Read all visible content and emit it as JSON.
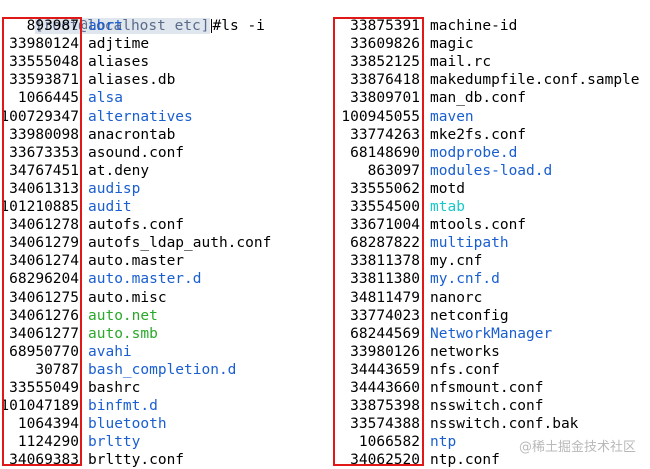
{
  "prompt": {
    "host": "[root@localhost etc]",
    "command": "#ls -i"
  },
  "colors": {
    "dir": "#1a5fd0",
    "exec": "#2aa82a",
    "link": "#18c8c8",
    "highlight_box": "#e01818"
  },
  "left_column": [
    {
      "inode": "893987",
      "name": "abrt",
      "type": "dir"
    },
    {
      "inode": "33980124",
      "name": "adjtime",
      "type": "file"
    },
    {
      "inode": "33555048",
      "name": "aliases",
      "type": "file"
    },
    {
      "inode": "33593871",
      "name": "aliases.db",
      "type": "file"
    },
    {
      "inode": "1066445",
      "name": "alsa",
      "type": "dir"
    },
    {
      "inode": "100729347",
      "name": "alternatives",
      "type": "dir"
    },
    {
      "inode": "33980098",
      "name": "anacrontab",
      "type": "file"
    },
    {
      "inode": "33673353",
      "name": "asound.conf",
      "type": "file"
    },
    {
      "inode": "34767451",
      "name": "at.deny",
      "type": "file"
    },
    {
      "inode": "34061313",
      "name": "audisp",
      "type": "dir"
    },
    {
      "inode": "101210885",
      "name": "audit",
      "type": "dir"
    },
    {
      "inode": "34061278",
      "name": "autofs.conf",
      "type": "file"
    },
    {
      "inode": "34061279",
      "name": "autofs_ldap_auth.conf",
      "type": "file"
    },
    {
      "inode": "34061274",
      "name": "auto.master",
      "type": "file"
    },
    {
      "inode": "68296204",
      "name": "auto.master.d",
      "type": "dir"
    },
    {
      "inode": "34061275",
      "name": "auto.misc",
      "type": "file"
    },
    {
      "inode": "34061276",
      "name": "auto.net",
      "type": "exec"
    },
    {
      "inode": "34061277",
      "name": "auto.smb",
      "type": "exec"
    },
    {
      "inode": "68950770",
      "name": "avahi",
      "type": "dir"
    },
    {
      "inode": "30787",
      "name": "bash_completion.d",
      "type": "dir"
    },
    {
      "inode": "33555049",
      "name": "bashrc",
      "type": "file"
    },
    {
      "inode": "101047189",
      "name": "binfmt.d",
      "type": "dir"
    },
    {
      "inode": "1064394",
      "name": "bluetooth",
      "type": "dir"
    },
    {
      "inode": "1124290",
      "name": "brltty",
      "type": "dir"
    },
    {
      "inode": "34069383",
      "name": "brltty.conf",
      "type": "file"
    }
  ],
  "right_column": [
    {
      "inode": "33875391",
      "name": "machine-id",
      "type": "file"
    },
    {
      "inode": "33609826",
      "name": "magic",
      "type": "file"
    },
    {
      "inode": "33852125",
      "name": "mail.rc",
      "type": "file"
    },
    {
      "inode": "33876418",
      "name": "makedumpfile.conf.sample",
      "type": "file"
    },
    {
      "inode": "33809701",
      "name": "man_db.conf",
      "type": "file"
    },
    {
      "inode": "100945055",
      "name": "maven",
      "type": "dir"
    },
    {
      "inode": "33774263",
      "name": "mke2fs.conf",
      "type": "file"
    },
    {
      "inode": "68148690",
      "name": "modprobe.d",
      "type": "dir"
    },
    {
      "inode": "863097",
      "name": "modules-load.d",
      "type": "dir"
    },
    {
      "inode": "33555062",
      "name": "motd",
      "type": "file"
    },
    {
      "inode": "33554500",
      "name": "mtab",
      "type": "link"
    },
    {
      "inode": "33671004",
      "name": "mtools.conf",
      "type": "file"
    },
    {
      "inode": "68287822",
      "name": "multipath",
      "type": "dir"
    },
    {
      "inode": "33811378",
      "name": "my.cnf",
      "type": "file"
    },
    {
      "inode": "33811380",
      "name": "my.cnf.d",
      "type": "dir"
    },
    {
      "inode": "34811479",
      "name": "nanorc",
      "type": "file"
    },
    {
      "inode": "33774023",
      "name": "netconfig",
      "type": "file"
    },
    {
      "inode": "68244569",
      "name": "NetworkManager",
      "type": "dir"
    },
    {
      "inode": "33980126",
      "name": "networks",
      "type": "file"
    },
    {
      "inode": "34443659",
      "name": "nfs.conf",
      "type": "file"
    },
    {
      "inode": "34443660",
      "name": "nfsmount.conf",
      "type": "file"
    },
    {
      "inode": "33875398",
      "name": "nsswitch.conf",
      "type": "file"
    },
    {
      "inode": "33574388",
      "name": "nsswitch.conf.bak",
      "type": "file"
    },
    {
      "inode": "1066582",
      "name": "ntp",
      "type": "dir"
    },
    {
      "inode": "34062520",
      "name": "ntp.conf",
      "type": "file"
    }
  ],
  "watermark": "@稀土掘金技术社区"
}
